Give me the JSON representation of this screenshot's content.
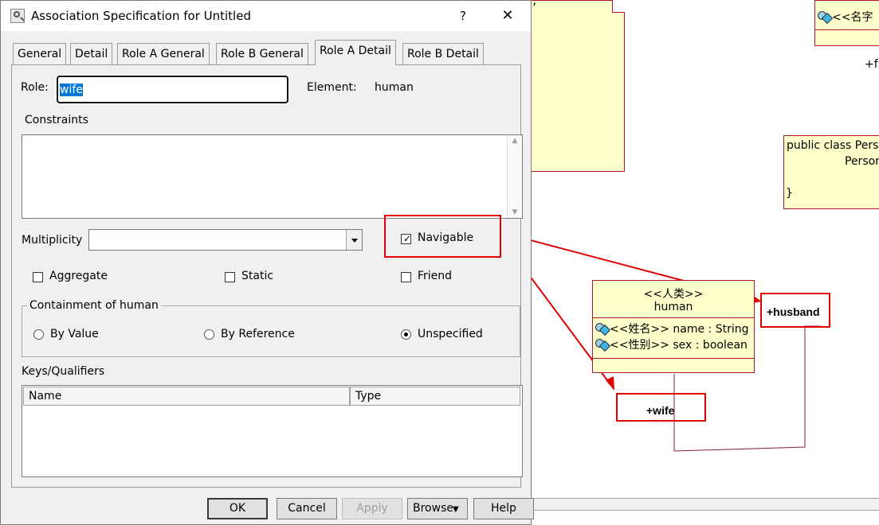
{
  "dialog": {
    "title": "Association Specification for Untitled",
    "help_glyph": "?",
    "close_glyph": "✕",
    "tabs": [
      {
        "label": "General"
      },
      {
        "label": "Detail"
      },
      {
        "label": "Role A General"
      },
      {
        "label": "Role B General"
      },
      {
        "label": "Role A Detail",
        "active": true
      },
      {
        "label": "Role B Detail"
      }
    ],
    "role_label": "Role:",
    "role_value": "wife",
    "element_label": "Element:",
    "element_value": "human",
    "constraints_label": "Constraints",
    "multiplicity_label": "Multiplicity",
    "multiplicity_value": "",
    "navigable": {
      "label": "Navigable",
      "checked": true
    },
    "aggregate": {
      "label": "Aggregate",
      "checked": false
    },
    "static": {
      "label": "Static",
      "checked": false
    },
    "friend": {
      "label": "Friend",
      "checked": false
    },
    "containment": {
      "title": "Containment of human",
      "options": [
        {
          "label": "By Value",
          "selected": false
        },
        {
          "label": "By Reference",
          "selected": false
        },
        {
          "label": "Unspecified",
          "selected": true
        }
      ]
    },
    "keys_label": "Keys/Qualifiers",
    "keys_columns": [
      "Name",
      "Type"
    ],
    "buttons": {
      "ok": "OK",
      "cancel": "Cancel",
      "apply": "Apply",
      "browse": "Browse",
      "help": "Help"
    }
  },
  "diagram": {
    "top_class_attr": "<<名字",
    "top_right_fragment": "+fr",
    "note_line1": "public class Pers",
    "note_line2": "Person",
    "note_line3": "}",
    "stray_char": "’",
    "human_class": {
      "stereotype": "<<人类>>",
      "name": "human",
      "attributes": [
        "<<姓名>> name : String",
        "<<性别>> sex : boolean"
      ]
    },
    "role_husband": "+husband",
    "role_wife": "+wife"
  },
  "colors": {
    "uml_fill": "#ffffcc",
    "uml_border": "#b0172f",
    "annotation_red": "#e00000",
    "dialog_bg": "#f0f0f0",
    "selection": "#0078d7"
  }
}
